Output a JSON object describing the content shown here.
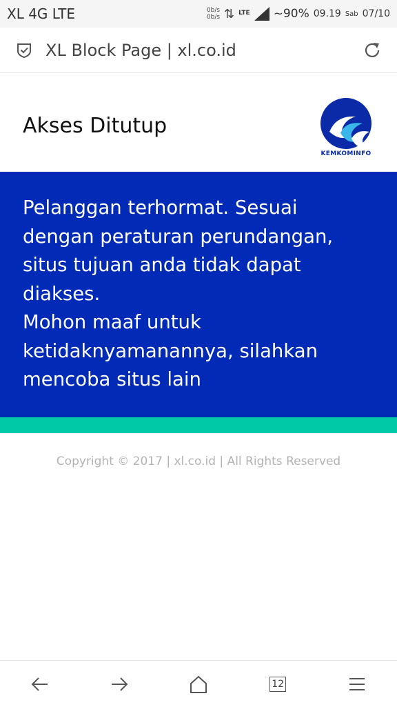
{
  "status_bar": {
    "carrier": "XL 4G LTE",
    "speed_up": "0b/s",
    "speed_down": "0b/s",
    "network_small": "LTE",
    "battery": "~90%",
    "time": "09.19",
    "day": "Sab",
    "date": "07/10"
  },
  "url_bar": {
    "title": "XL Block Page | xl.co.id",
    "shield_icon": "shield-check-icon",
    "reload_icon": "reload-icon"
  },
  "header": {
    "title": "Akses Ditutup",
    "logo_text": "KEMKOMINFO"
  },
  "notice": {
    "paragraph1": "Pelanggan terhormat. Sesuai dengan peraturan perundangan, situs tujuan anda tidak dapat diakses.",
    "paragraph2": "Mohon maaf untuk ketidaknyamanannya, silahkan mencoba situs lain"
  },
  "footer": {
    "copyright": "Copyright © 2017 | xl.co.id | All Rights Reserved"
  },
  "nav": {
    "tab_count": "12",
    "icons": [
      "back-arrow-icon",
      "forward-arrow-icon",
      "home-icon",
      "tabs-icon",
      "menu-icon"
    ]
  },
  "colors": {
    "panel_blue": "#012bb7",
    "band_teal": "#00c9a7",
    "logo_blue": "#0a2aa8"
  }
}
